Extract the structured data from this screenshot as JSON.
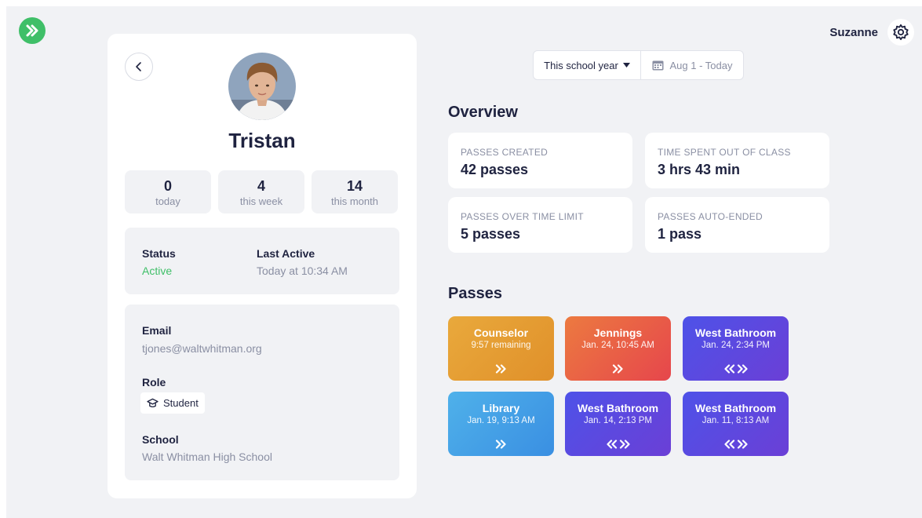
{
  "header": {
    "user_name": "Suzanne"
  },
  "profile": {
    "name": "Tristan",
    "stats": [
      {
        "value": "0",
        "label": "today"
      },
      {
        "value": "4",
        "label": "this week"
      },
      {
        "value": "14",
        "label": "this month"
      }
    ],
    "status": {
      "label": "Status",
      "value": "Active",
      "color": "#3fbf68"
    },
    "last_active": {
      "label": "Last Active",
      "value": "Today at 10:34 AM"
    },
    "email": {
      "label": "Email",
      "value": "tjones@waltwhitman.org"
    },
    "role": {
      "label": "Role",
      "value": "Student"
    },
    "school": {
      "label": "School",
      "value": "Walt Whitman High School"
    }
  },
  "filter": {
    "range_label": "This school year",
    "date_label": "Aug 1 - Today"
  },
  "overview": {
    "title": "Overview",
    "cards": [
      {
        "label": "PASSES CREATED",
        "value": "42 passes"
      },
      {
        "label": "TIME SPENT OUT OF CLASS",
        "value": "3 hrs 43 min"
      },
      {
        "label": "PASSES OVER TIME LIMIT",
        "value": "5 passes"
      },
      {
        "label": "PASSES AUTO-ENDED",
        "value": "1 pass"
      }
    ]
  },
  "passes": {
    "title": "Passes",
    "items": [
      {
        "name": "Counselor",
        "sub": "9:57 remaining",
        "icon": "chevron-right-double-icon",
        "color": "#e6a035"
      },
      {
        "name": "Jennings",
        "sub": "Jan. 24, 10:45 AM",
        "icon": "chevron-right-double-icon",
        "color": "#e95a47"
      },
      {
        "name": "West Bathroom",
        "sub": "Jan. 24, 2:34 PM",
        "icon": "chevron-both-double-icon",
        "color": "#5a4ae2"
      },
      {
        "name": "Library",
        "sub": "Jan. 19, 9:13 AM",
        "icon": "chevron-right-double-icon",
        "color": "#44a2e8"
      },
      {
        "name": "West Bathroom",
        "sub": "Jan. 14, 2:13 PM",
        "icon": "chevron-both-double-icon",
        "color": "#5a4ae2"
      },
      {
        "name": "West Bathroom",
        "sub": "Jan. 11, 8:13 AM",
        "icon": "chevron-both-double-icon",
        "color": "#5a4ae2"
      }
    ]
  },
  "colors": {
    "accent_green": "#3fbf68",
    "page_bg": "#f1f2f5",
    "text_dark": "#1f2340",
    "text_muted": "#8a8fa3"
  }
}
